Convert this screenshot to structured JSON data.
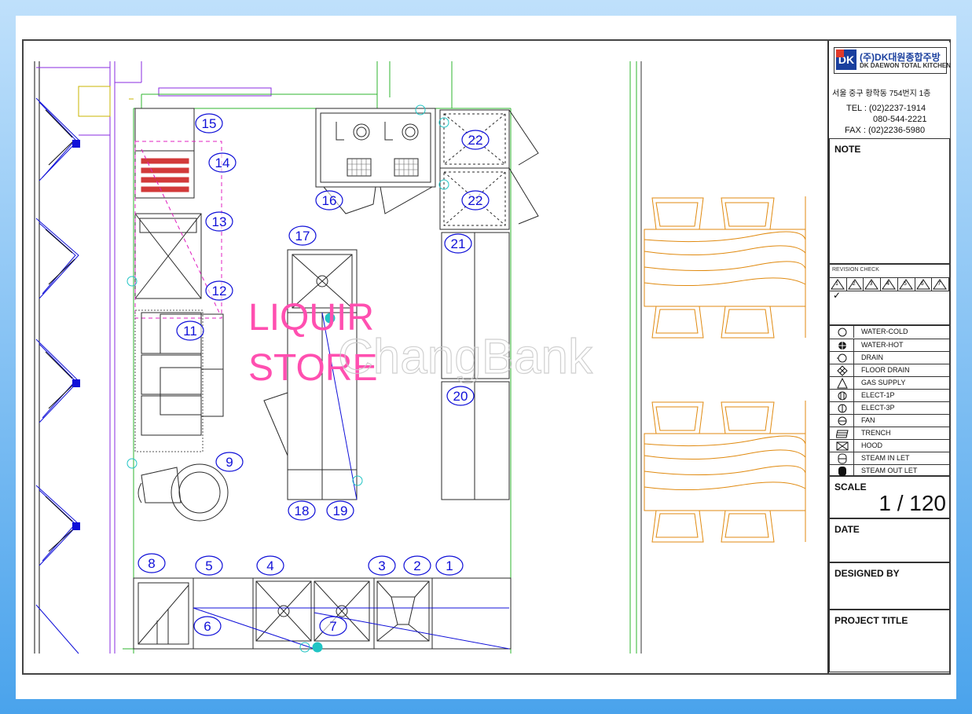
{
  "drawing": {
    "store_label_line1": "LIQUIR",
    "store_label_line2": "STORE",
    "watermark": "ChangBank",
    "equipment_numbers": [
      "1",
      "2",
      "3",
      "4",
      "5",
      "6",
      "7",
      "8",
      "9",
      "11",
      "12",
      "13",
      "14",
      "15",
      "16",
      "17",
      "18",
      "19",
      "20",
      "21",
      "22",
      "22"
    ]
  },
  "title_block": {
    "company_logo_text": "DK",
    "company_name_kr": "(주)DK대원종합주방",
    "company_name_en": "DK DAEWON TOTAL KITCHEN",
    "address": "서울 중구 황학동 754번지 1층",
    "tel": "TEL : (02)2237-1914",
    "tel2": "080-544-2221",
    "fax": "FAX : (02)2236-5980",
    "note_label": "NOTE",
    "revision_label": "REVISION CHECK",
    "revision_marks": [
      "1",
      "2",
      "3",
      "4",
      "5",
      "6",
      "7"
    ],
    "legend": [
      {
        "icon": "water-cold-icon",
        "label": "WATER-COLD"
      },
      {
        "icon": "water-hot-icon",
        "label": "WATER-HOT"
      },
      {
        "icon": "drain-icon",
        "label": "DRAIN"
      },
      {
        "icon": "floor-drain-icon",
        "label": "FLOOR DRAIN"
      },
      {
        "icon": "gas-supply-icon",
        "label": "GAS SUPPLY"
      },
      {
        "icon": "elect-1p-icon",
        "label": "ELECT-1P"
      },
      {
        "icon": "elect-3p-icon",
        "label": "ELECT-3P"
      },
      {
        "icon": "fan-icon",
        "label": "FAN"
      },
      {
        "icon": "trench-icon",
        "label": "TRENCH"
      },
      {
        "icon": "hood-icon",
        "label": "HOOD"
      },
      {
        "icon": "steam-inlet-icon",
        "label": "STEAM IN LET"
      },
      {
        "icon": "steam-outlet-icon",
        "label": "STEAM OUT LET"
      }
    ],
    "scale_label": "SCALE",
    "scale_value": "1 / 120",
    "date_label": "DATE",
    "designed_by_label": "DESIGNED BY",
    "project_title_label": "PROJECT TITLE"
  },
  "colors": {
    "equipment_line": "#2a2a2a",
    "wall_green": "#2fb52f",
    "wall_purple": "#8a2be2",
    "tag_blue": "#1010d8",
    "pink_label": "#ff4fb0",
    "furniture_orange": "#e08a10",
    "magenta_dash": "#e020c0",
    "cyan_mark": "#21c4c4"
  }
}
